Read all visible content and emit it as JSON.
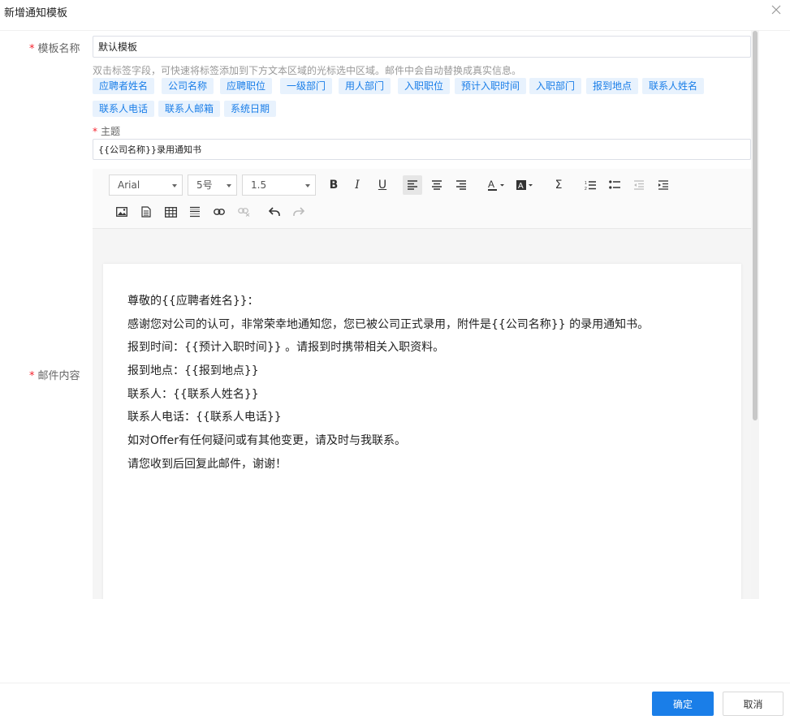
{
  "dialog": {
    "title": "新增通知模板",
    "close_icon": "close-icon"
  },
  "form": {
    "name_label": "模板名称",
    "name_value": "默认模板",
    "hint": "双击标签字段，可快速将标签添加到下方文本区域的光标选中区域。邮件中会自动替换成真实信息。",
    "tags": [
      "应聘者姓名",
      "公司名称",
      "应聘职位",
      "一级部门",
      "用人部门",
      "入职职位",
      "预计入职时间",
      "入职部门",
      "报到地点",
      "联系人姓名",
      "联系人电话",
      "联系人邮箱",
      "系统日期"
    ],
    "subject_label": "主题",
    "subject_value": "{{公司名称}}录用通知书",
    "content_label": "邮件内容"
  },
  "toolbar": {
    "font_family": "Arial",
    "font_size": "5号",
    "line_height": "1.5",
    "icons": [
      "bold-icon",
      "italic-icon",
      "underline-icon",
      "align-left-icon",
      "align-center-icon",
      "align-right-icon",
      "font-color-icon",
      "background-color-icon",
      "formula-icon",
      "ordered-list-icon",
      "unordered-list-icon",
      "outdent-icon",
      "indent-icon",
      "image-icon",
      "attachment-icon",
      "table-icon",
      "horizontal-rule-icon",
      "link-icon",
      "unlink-icon",
      "undo-icon",
      "redo-icon"
    ]
  },
  "content": {
    "lines": [
      "尊敬的{{应聘者姓名}}：",
      "感谢您对公司的认可，非常荣幸地通知您，您已被公司正式录用，附件是{{公司名称}} 的录用通知书。",
      "报到时间：{{预计入职时间}} 。请报到时携带相关入职资料。",
      "报到地点：{{报到地点}}",
      "联系人：{{联系人姓名}}",
      "联系人电话：{{联系人电话}}",
      "如对Offer有任何疑问或有其他变更，请及时与我联系。",
      "请您收到后回复此邮件，谢谢！"
    ]
  },
  "footer": {
    "confirm_label": "确定",
    "cancel_label": "取消"
  },
  "colors": {
    "primary": "#1a7ee8",
    "tag_bg": "#e8f2fd",
    "required": "#f5222d"
  }
}
